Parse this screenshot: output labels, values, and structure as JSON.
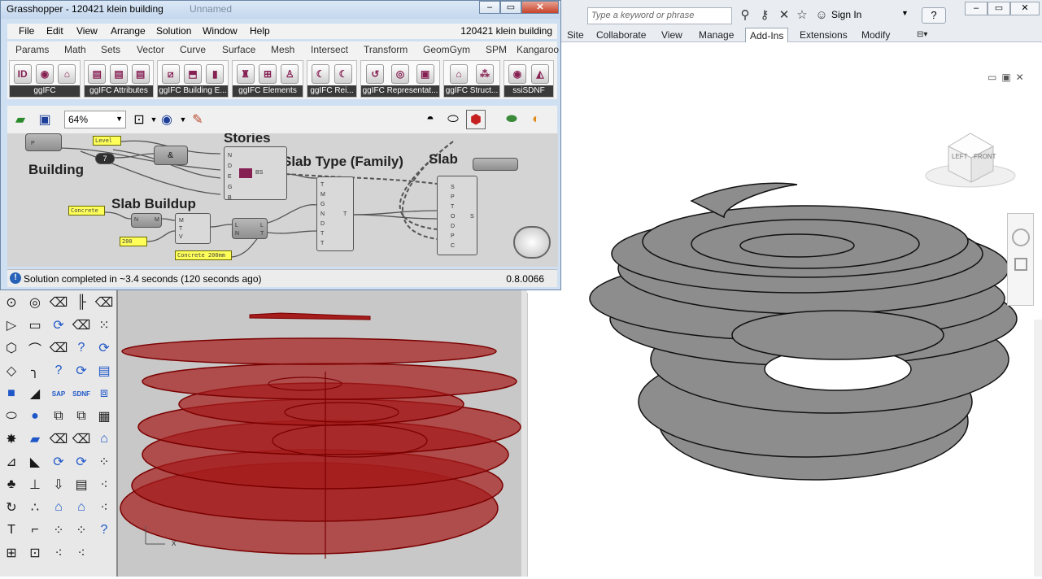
{
  "gh": {
    "title": "Grasshopper - 120421 klein building",
    "ghost_title": "Unnamed",
    "menu": [
      "File",
      "Edit",
      "View",
      "Arrange",
      "Solution",
      "Window",
      "Help"
    ],
    "doc_name": "120421 klein building",
    "tabs": [
      "Params",
      "Math",
      "Sets",
      "Vector",
      "Curve",
      "Surface",
      "Mesh",
      "Intersect",
      "Transform",
      "GeomGym",
      "SPM",
      "Kangaroo"
    ],
    "ribbon_groups": [
      "ggIFC",
      "ggIFC Attributes",
      "ggIFC Building E...",
      "ggIFC Elements",
      "ggIFC Rei...",
      "ggIFC Representat...",
      "ggIFC Struct...",
      "ssiSDNF"
    ],
    "zoom": "64%",
    "canvas": {
      "labels": {
        "building": "Building",
        "stories": "Stories",
        "slab_type": "Slab Type (Family)",
        "slab": "Slab",
        "slab_buildup": "Slab Buildup"
      },
      "panels": {
        "level": "Level",
        "concrete": "Concrete",
        "thickness": "200",
        "concrete_200": "Concrete 200mm"
      },
      "counter": "7"
    },
    "status": "Solution completed in ~3.4 seconds (120 seconds ago)",
    "version": "0.8.0066"
  },
  "revit": {
    "search_placeholder": "Type a keyword or phrase",
    "sign_in": "Sign In",
    "help": "?",
    "tabs": [
      "Site",
      "Collaborate",
      "View",
      "Manage",
      "Add-Ins",
      "Extensions",
      "Modify"
    ],
    "active_tab": "Add-Ins",
    "viewcube": {
      "left": "LEFT",
      "front": "FRONT"
    }
  },
  "rhino": {
    "axis": "x"
  },
  "colors": {
    "rhino_slab": "#a51c1c",
    "revit_slab": "#8d8d8d",
    "gh_panel": "#ffff5a",
    "gh_node": "#a0a0a0"
  }
}
